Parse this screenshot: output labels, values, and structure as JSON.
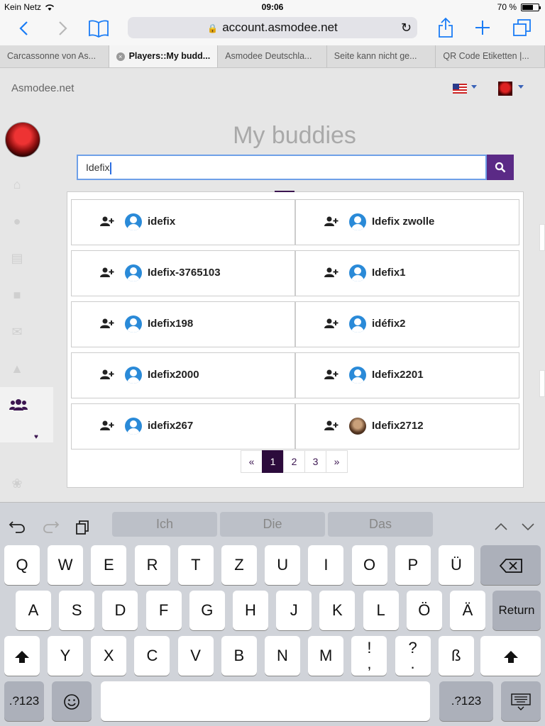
{
  "status": {
    "carrier": "Kein Netz",
    "time": "09:06",
    "battery": "70 %",
    "battery_level": 0.7
  },
  "browser": {
    "url": "account.asmodee.net",
    "tabs": [
      {
        "label": "Carcassonne von As...",
        "active": false
      },
      {
        "label": "Players::My budd...",
        "active": true
      },
      {
        "label": "Asmodee Deutschla...",
        "active": false
      },
      {
        "label": "Seite kann nicht ge...",
        "active": false
      },
      {
        "label": "QR Code Etiketten |...",
        "active": false
      }
    ],
    "icons": {
      "back": "chevron-left-icon",
      "forward": "chevron-right-icon",
      "bookmarks": "book-icon",
      "share": "share-icon",
      "new_tab": "plus-icon",
      "tabs": "tabs-icon",
      "reload": "reload-icon",
      "lock": "lock-icon"
    }
  },
  "site": {
    "name": "Asmodee.net"
  },
  "page": {
    "title": "My buddies",
    "search_value": "Idefix",
    "results": [
      {
        "name": "idefix",
        "avatar": "default"
      },
      {
        "name": "Idefix zwolle",
        "avatar": "default"
      },
      {
        "name": "Idefix-3765103",
        "avatar": "default"
      },
      {
        "name": "Idefix1",
        "avatar": "default"
      },
      {
        "name": "Idefix198",
        "avatar": "default"
      },
      {
        "name": "idéfix2",
        "avatar": "default"
      },
      {
        "name": "Idefix2000",
        "avatar": "default"
      },
      {
        "name": "Idefix2201",
        "avatar": "default"
      },
      {
        "name": "idefix267",
        "avatar": "default"
      },
      {
        "name": "Idefix2712",
        "avatar": "photo"
      }
    ],
    "pagination": {
      "prev": "«",
      "pages": [
        "1",
        "2",
        "3"
      ],
      "current": "1",
      "next": "»"
    }
  },
  "keyboard": {
    "suggestions": [
      "Ich",
      "Die",
      "Das"
    ],
    "row1": [
      "Q",
      "W",
      "E",
      "R",
      "T",
      "Z",
      "U",
      "I",
      "O",
      "P",
      "Ü"
    ],
    "row2": [
      "A",
      "S",
      "D",
      "F",
      "G",
      "H",
      "J",
      "K",
      "L",
      "Ö",
      "Ä"
    ],
    "row3": [
      "Y",
      "X",
      "C",
      "V",
      "B",
      "N",
      "M",
      "!\n,",
      "?\n.",
      "ß"
    ],
    "return_label": "Return",
    "num_label": ".?123",
    "accent": "#5b2a86",
    "pager_active": "#2c0b3c"
  }
}
